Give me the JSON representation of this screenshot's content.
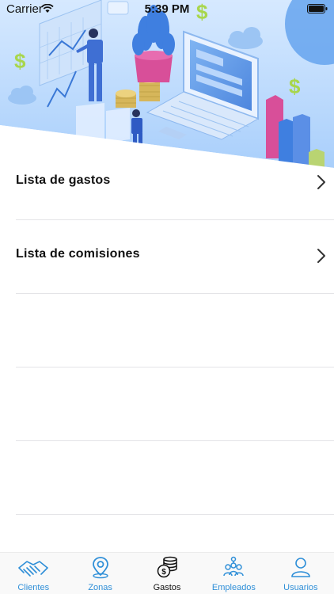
{
  "status": {
    "carrier": "Carrier",
    "time": "5:39 PM"
  },
  "hero": {
    "icon": "finance-illustration"
  },
  "list": {
    "items": [
      {
        "label": "Lista de gastos",
        "icon": "chevron-right-icon"
      },
      {
        "label": "Lista de comisiones",
        "icon": "chevron-right-icon"
      }
    ]
  },
  "tabbar": {
    "tabs": [
      {
        "label": "Clientes",
        "icon": "handshake-icon",
        "active": false
      },
      {
        "label": "Zonas",
        "icon": "location-pin-icon",
        "active": false
      },
      {
        "label": "Gastos",
        "icon": "coins-icon",
        "active": true
      },
      {
        "label": "Empleados",
        "icon": "people-icon",
        "active": false
      },
      {
        "label": "Usuarios",
        "icon": "user-icon",
        "active": false
      }
    ]
  },
  "colors": {
    "accent": "#2f8fd8",
    "active_tab": "#111111",
    "hero_sky": "#bfdcff"
  }
}
